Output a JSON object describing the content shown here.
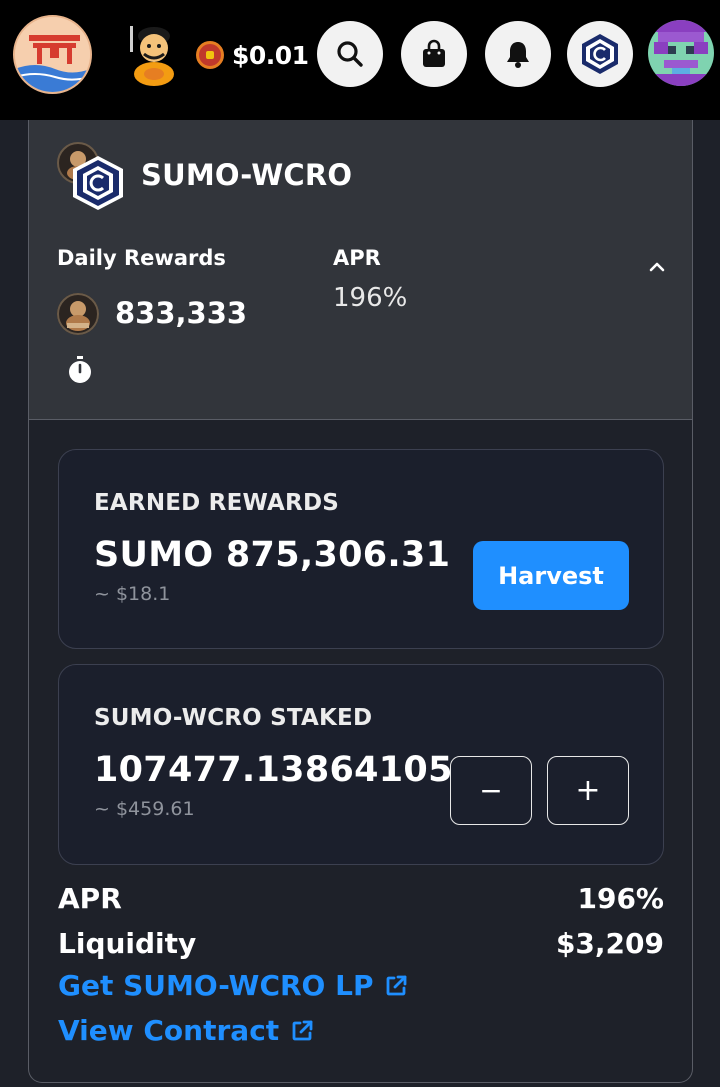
{
  "header": {
    "token_price": "$0.01",
    "icons": [
      "site-logo",
      "mascot-icon",
      "coin-icon",
      "search-icon",
      "bag-icon",
      "bell-icon",
      "cronos-icon",
      "avatar"
    ]
  },
  "farm": {
    "pair_name": "SUMO-WCRO",
    "daily_rewards_label": "Daily Rewards",
    "daily_rewards_value": "833,333",
    "apr_label": "APR",
    "apr_value": "196%",
    "earned": {
      "title": "EARNED REWARDS",
      "amount": "SUMO 875,306.31",
      "usd": "~ $18.1",
      "harvest_label": "Harvest"
    },
    "staked": {
      "title": "SUMO-WCRO STAKED",
      "amount": "107477.13864105",
      "usd": "~ $459.61",
      "minus_label": "−",
      "plus_label": "+"
    },
    "stats": [
      {
        "label": "APR",
        "value": "196%"
      },
      {
        "label": "Liquidity",
        "value": "$3,209"
      }
    ],
    "links": {
      "get_lp": "Get SUMO-WCRO LP",
      "view_contract": "View Contract"
    }
  },
  "colors": {
    "accent": "#1f8fff",
    "panel_header": "#32353b",
    "card_bg": "#1b1f2c",
    "topbar": "#000000"
  }
}
